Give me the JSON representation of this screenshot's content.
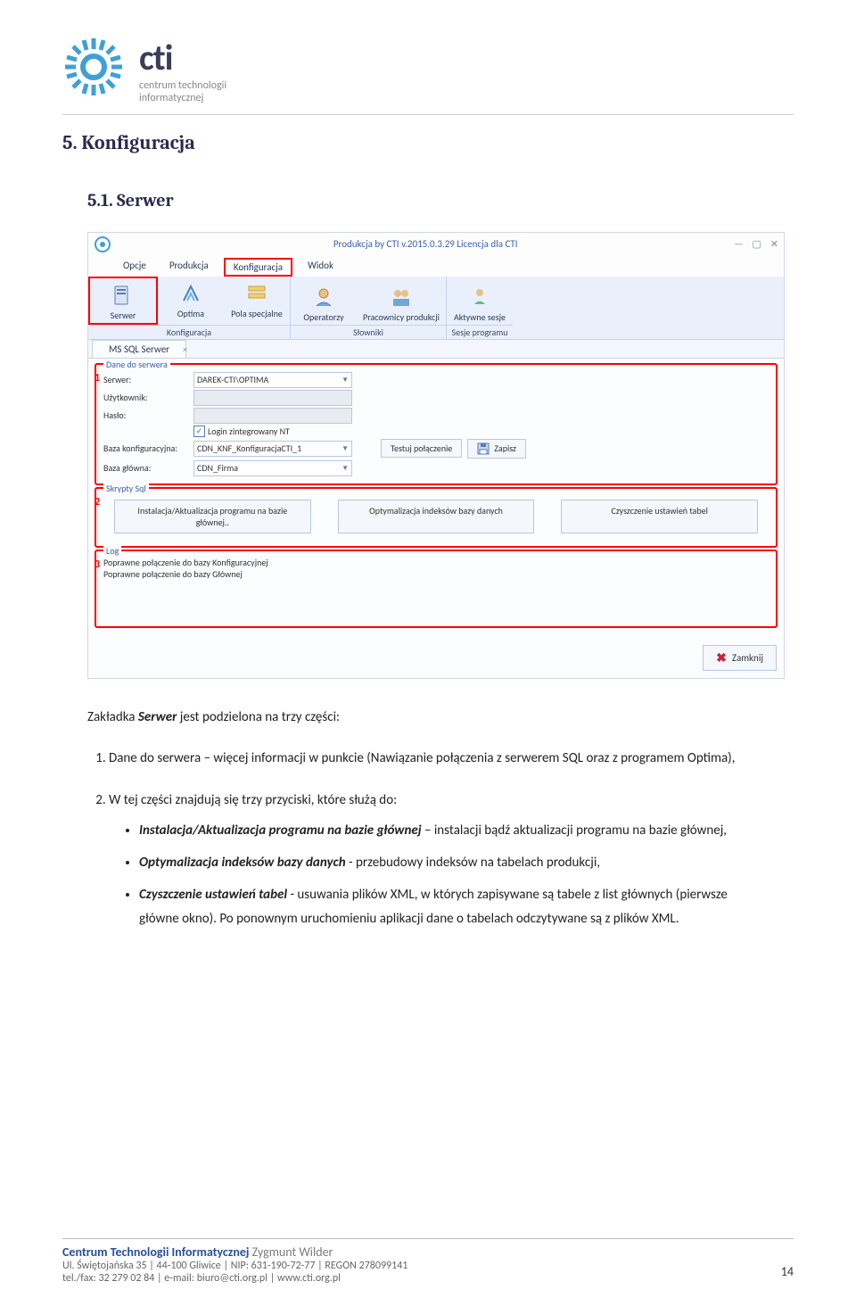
{
  "logo": {
    "brand": "cti",
    "sub1": "centrum technologii",
    "sub2": "informatycznej"
  },
  "h2": "5.  Konfiguracja",
  "h3": "5.1.    Serwer",
  "ss": {
    "title": "Produkcja by CTI v.2015.0.3.29 Licencja dla CTI",
    "win": {
      "min": "—",
      "max": "▢",
      "close": "✕"
    },
    "menu": {
      "opcje": "Opcje",
      "produkcja": "Produkcja",
      "konfig": "Konfiguracja",
      "widok": "Widok"
    },
    "ribbon": {
      "g1": {
        "serwer": "Serwer",
        "optima": "Optima",
        "pola": "Pola specjalne",
        "lbl": "Konfiguracja"
      },
      "g2": {
        "oper": "Operatorzy",
        "prac": "Pracownicy produkcji",
        "lbl": "Słowniki"
      },
      "g3": {
        "sesje": "Aktywne sesje",
        "lbl": "Sesje programu"
      }
    },
    "tab": "MS SQL Serwer",
    "panel1": {
      "legend": "Dane do serwera",
      "num": "1",
      "lbl_serwer": "Serwer:",
      "val_serwer": "DAREK-CTI\\OPTIMA",
      "lbl_uzyt": "Użytkownik:",
      "lbl_haslo": "Hasło:",
      "chk": "Login zintegrowany NT",
      "lbl_bk": "Baza konfiguracyjna:",
      "val_bk": "CDN_KNF_KonfiguracjaCTI_1",
      "lbl_bg": "Baza główna:",
      "val_bg": "CDN_Firma",
      "btn_test": "Testuj połączenie",
      "btn_save": "Zapisz"
    },
    "panel2": {
      "legend": "Skrypty Sql",
      "num": "2",
      "b1": "Instalacja/Aktualizacja programu na bazie głównej..",
      "b2": "Optymalizacja indeksów bazy danych",
      "b3": "Czyszczenie ustawień tabel"
    },
    "panel3": {
      "legend": "Log",
      "num": "3",
      "l1": "Poprawne połączenie do bazy Konfiguracyjnej",
      "l2": "Poprawne połączenie do bazy Głównej"
    },
    "btn_close": "Zamknij"
  },
  "intro": {
    "t1": "Zakładka ",
    "b1": "Serwer",
    "t2": " jest podzielona na trzy części:"
  },
  "list": {
    "i1": {
      "a": "Dane do serwera – więcej informacji w punkcie (Nawiązanie połączenia z serwerem SQL oraz z programem Optima),"
    },
    "i2": {
      "a": "W tej części znajdują się trzy przyciski, które służą do:",
      "s1b": "Instalacja/Aktualizacja programu na bazie głównej",
      "s1t": " – instalacji bądź aktualizacji programu na bazie głównej,",
      "s2b": "Optymalizacja indeksów bazy danych",
      "s2t": " - przebudowy indeksów na tabelach produkcji,",
      "s3b": "Czyszczenie ustawień tabel",
      "s3t": " - usuwania plików XML, w których zapisywane są tabele z list głównych (pierwsze główne okno). Po ponownym uruchomieniu aplikacji dane o tabelach odczytywane są z plików XML."
    }
  },
  "footer": {
    "name1": "Centrum Technologii Informatycznej",
    "name2": " Zygmunt Wilder",
    "l1": "Ul. Świętojańska 35 | 44-100 Gliwice | NIP: 631-190-72-77 | REGON 278099141",
    "l2": "tel./fax: 32 279 02 84 | e-mail: biuro@cti.org.pl | www.cti.org.pl",
    "page": "14"
  }
}
